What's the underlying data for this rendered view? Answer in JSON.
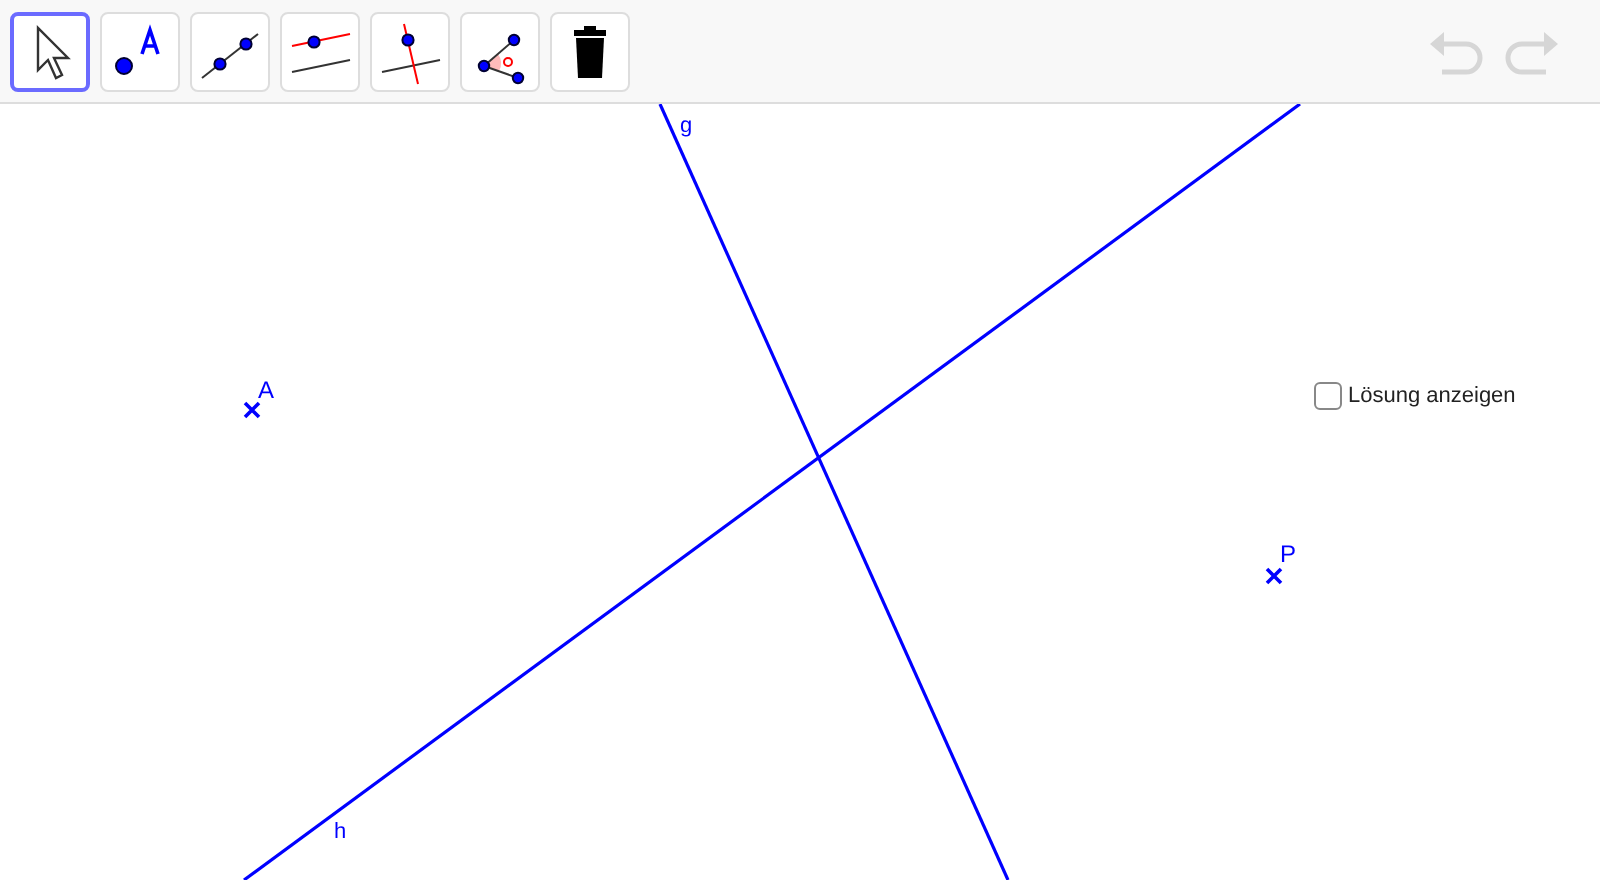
{
  "toolbar": {
    "tools": [
      {
        "kind": "move",
        "selected": true
      },
      {
        "kind": "point",
        "selected": false
      },
      {
        "kind": "line",
        "selected": false
      },
      {
        "kind": "parallel",
        "selected": false
      },
      {
        "kind": "perpendicular",
        "selected": false
      },
      {
        "kind": "angle",
        "selected": false
      },
      {
        "kind": "delete",
        "selected": false
      }
    ],
    "undo": {
      "disabled": true
    },
    "redo": {
      "disabled": true
    }
  },
  "canvas": {
    "lines": [
      {
        "label": "g"
      },
      {
        "label": "h"
      }
    ],
    "points": [
      {
        "label": "A"
      },
      {
        "label": "P"
      }
    ],
    "checkbox": {
      "label": "Lösung anzeigen",
      "checked": false
    }
  }
}
